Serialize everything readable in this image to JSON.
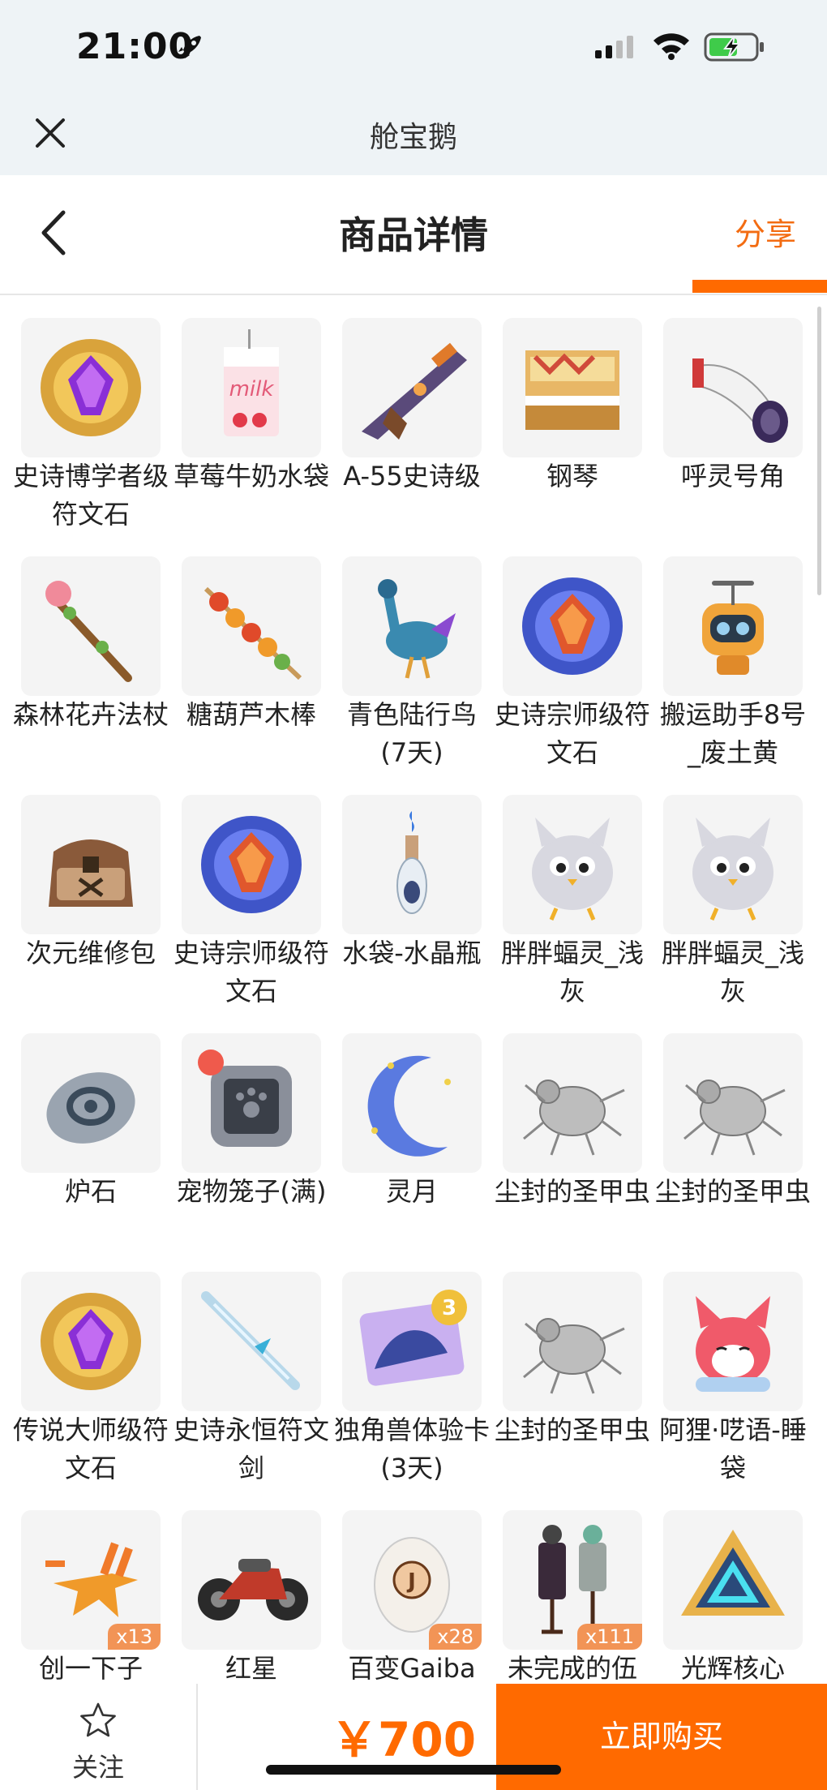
{
  "status_bar": {
    "time": "21:00",
    "icons": [
      "rocket-icon",
      "signal-icon",
      "wifi-icon",
      "battery-charging-icon"
    ]
  },
  "mini_header": {
    "title": "舱宝鹅",
    "close_icon": "close-icon"
  },
  "nav": {
    "back_icon": "chevron-left-icon",
    "title": "商品详情",
    "share": "分享"
  },
  "colors": {
    "accent": "#ff6a00",
    "share_text": "#f36c12",
    "thumb_bg": "#f4f4f4",
    "badge": "#f29456"
  },
  "items": [
    {
      "name": "史诗博学者级符文石",
      "art": "rune-gold",
      "badge": ""
    },
    {
      "name": "草莓牛奶水袋",
      "art": "milk",
      "badge": ""
    },
    {
      "name": "A-55史诗级",
      "art": "gun",
      "badge": ""
    },
    {
      "name": "钢琴",
      "art": "piano",
      "badge": ""
    },
    {
      "name": "呼灵号角",
      "art": "horn",
      "badge": ""
    },
    {
      "name": "森林花卉法杖",
      "art": "staff",
      "badge": ""
    },
    {
      "name": "糖葫芦木棒",
      "art": "skewer",
      "badge": ""
    },
    {
      "name": "青色陆行鸟(7天)",
      "art": "bird",
      "badge": ""
    },
    {
      "name": "史诗宗师级符文石",
      "art": "rune-blue",
      "badge": ""
    },
    {
      "name": "搬运助手8号_废土黄",
      "art": "robot",
      "badge": ""
    },
    {
      "name": "次元维修包",
      "art": "bag",
      "badge": ""
    },
    {
      "name": "史诗宗师级符文石",
      "art": "rune-blue",
      "badge": ""
    },
    {
      "name": "水袋-水晶瓶",
      "art": "bottle",
      "badge": ""
    },
    {
      "name": "胖胖蝠灵_浅灰",
      "art": "bat",
      "badge": ""
    },
    {
      "name": "胖胖蝠灵_浅灰",
      "art": "bat",
      "badge": ""
    },
    {
      "name": "炉石",
      "art": "stone",
      "badge": ""
    },
    {
      "name": "宠物笼子(满)",
      "art": "cage",
      "badge": ""
    },
    {
      "name": "灵月",
      "art": "moon",
      "badge": ""
    },
    {
      "name": "尘封的圣甲虫",
      "art": "beetle",
      "badge": ""
    },
    {
      "name": "尘封的圣甲虫",
      "art": "beetle",
      "badge": ""
    },
    {
      "name": "传说大师级符文石",
      "art": "rune-gold",
      "badge": ""
    },
    {
      "name": "史诗永恒符文剑",
      "art": "sword",
      "badge": ""
    },
    {
      "name": "独角兽体验卡(3天)",
      "art": "card",
      "badge": ""
    },
    {
      "name": "尘封的圣甲虫",
      "art": "beetle",
      "badge": ""
    },
    {
      "name": "阿狸·呓语-睡袋",
      "art": "fox",
      "badge": ""
    },
    {
      "name": "创一下子",
      "art": "burst",
      "badge": "x13"
    },
    {
      "name": "红星",
      "art": "bike",
      "badge": ""
    },
    {
      "name": "百变Gaiba",
      "art": "egg",
      "badge": "x28"
    },
    {
      "name": "未完成的伍",
      "art": "mannequin",
      "badge": "x111"
    },
    {
      "name": "光辉核心",
      "art": "core",
      "badge": ""
    }
  ],
  "bottom_bar": {
    "follow": "关注",
    "follow_icon": "star-icon",
    "price": "￥700",
    "buy": "立即购买"
  }
}
